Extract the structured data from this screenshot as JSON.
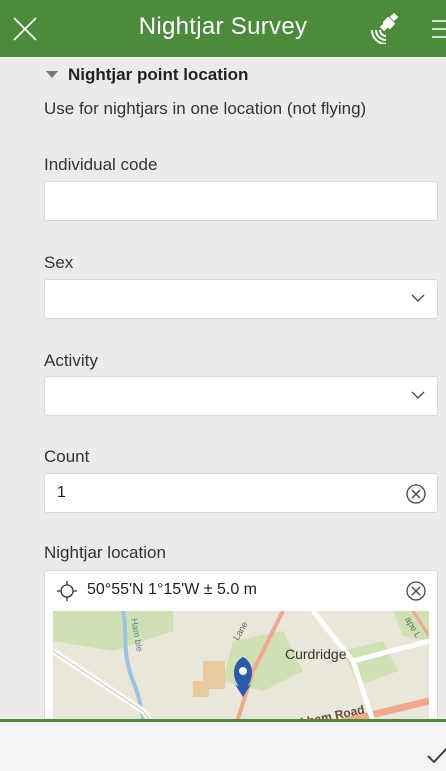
{
  "header": {
    "title": "Nightjar Survey"
  },
  "group": {
    "title": "Nightjar point location",
    "description": "Use for nightjars in one location (not flying)"
  },
  "fields": {
    "individual_code": {
      "label": "Individual code",
      "value": ""
    },
    "sex": {
      "label": "Sex",
      "value": ""
    },
    "activity": {
      "label": "Activity",
      "value": ""
    },
    "count": {
      "label": "Count",
      "value": "1"
    },
    "location": {
      "label": "Nightjar location",
      "value": "50°55'N 1°15'W ± 5.0 m"
    }
  },
  "map": {
    "labels": [
      "Curdridge",
      "Wickham Road",
      "Lane",
      "Ham ble",
      "Vi",
      "ape L"
    ]
  },
  "colors": {
    "brand": "#4c8a3c",
    "pin": "#2b5aa8"
  },
  "icons": [
    "close-icon",
    "gps-satellite-icon",
    "menu-icon",
    "chevron-down-icon",
    "clear-icon",
    "location-target-icon",
    "map-pin-icon",
    "checkmark-icon"
  ]
}
